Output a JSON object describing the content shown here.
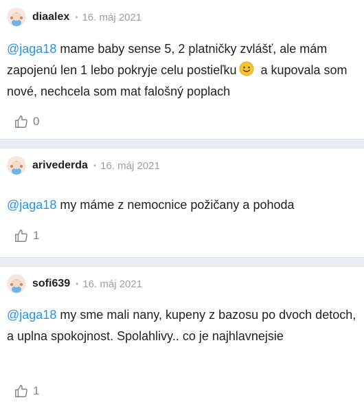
{
  "comments": [
    {
      "username": "diaalex",
      "date": "16. máj 2021",
      "mention": "@jaga18",
      "text_before_emoji": " mame baby sense 5, 2 platničky zvlášť, ale mám zapojenú len 1 lebo pokryje celu postieľku",
      "text_after_emoji": " a kupovala som nové, nechcela som mat falošný poplach",
      "likes": "0"
    },
    {
      "username": "arivederda",
      "date": "16. máj 2021",
      "mention": "@jaga18",
      "text": " my máme z nemocnice požičany a pohoda",
      "likes": "1"
    },
    {
      "username": "sofi639",
      "date": "16. máj 2021",
      "mention": "@jaga18",
      "text": " my sme mali nany, kupeny z bazosu po dvoch detoch, a uplna spokojnost. Spolahlivy.. co je najhlavnejsie",
      "likes": "1"
    }
  ],
  "separator_dot": "•",
  "colors": {
    "mention": "#2b8fe6",
    "meta": "#9a9fa6",
    "separator": "#eaedf1"
  },
  "icons": {
    "avatar": "default-avatar-icon",
    "emoji": "smile-emoji-icon",
    "like": "thumbs-up-icon"
  }
}
